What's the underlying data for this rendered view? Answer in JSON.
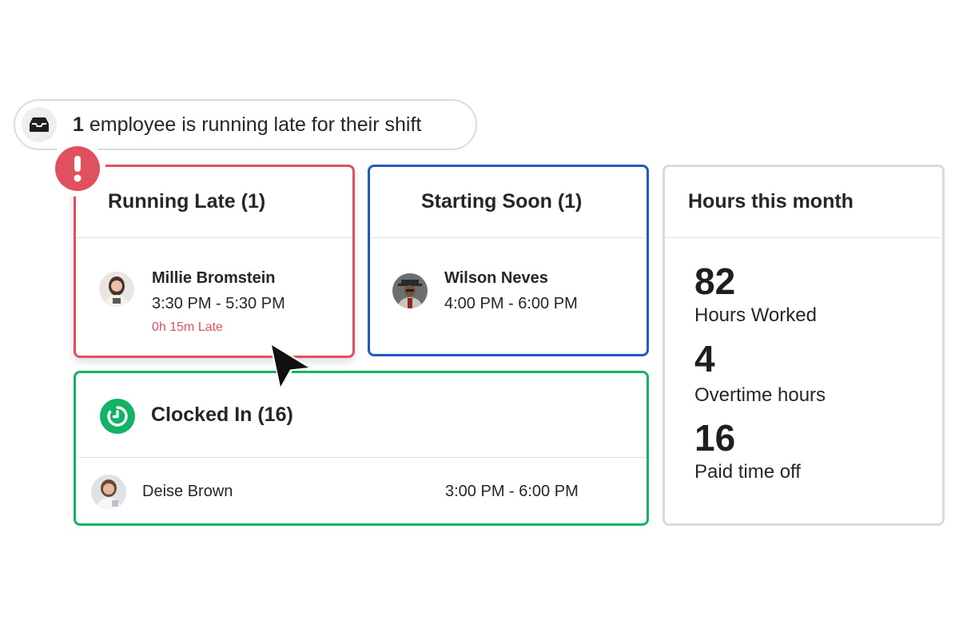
{
  "banner": {
    "count": "1",
    "text": " employee is running late for their shift",
    "icon": "inbox-icon"
  },
  "running_late": {
    "title": "Running Late (1)",
    "employee": {
      "name": "Millie Bromstein",
      "shift": "3:30 PM - 5:30 PM",
      "status": "0h 15m Late"
    },
    "accent_color": "#e1505f"
  },
  "starting_soon": {
    "title": "Starting Soon (1)",
    "employee": {
      "name": "Wilson Neves",
      "shift": "4:00 PM - 6:00 PM"
    },
    "accent_color": "#1e5ac8"
  },
  "hours_this_month": {
    "title": "Hours this month",
    "stats": [
      {
        "value": "82",
        "label": "Hours Worked"
      },
      {
        "value": "4",
        "label": "Overtime hours"
      },
      {
        "value": "16",
        "label": "Paid time off"
      }
    ]
  },
  "clocked_in": {
    "title": "Clocked In (16)",
    "employee": {
      "name": "Deise Brown",
      "shift": "3:00 PM - 6:00 PM"
    },
    "accent_color": "#12b365"
  }
}
